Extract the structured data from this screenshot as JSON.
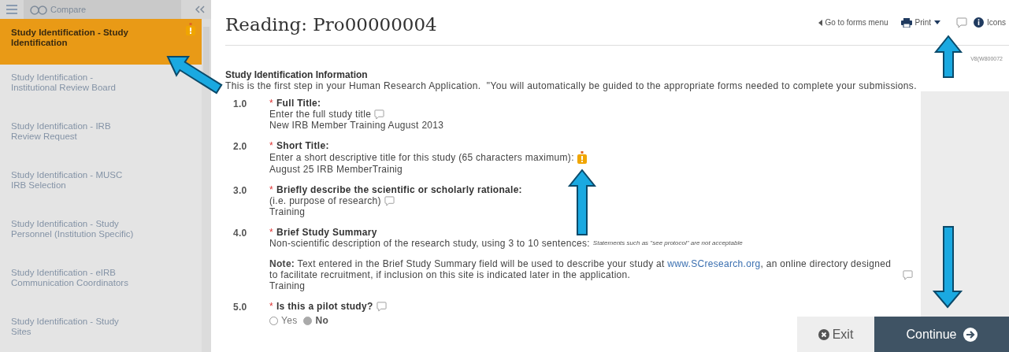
{
  "sidebar": {
    "header": {
      "label": "Compare"
    },
    "items": [
      {
        "label": "Study Identification - Study Identification",
        "selected": true,
        "alert": true
      },
      {
        "label": "Study Identification - Institutional Review Board",
        "selected": false,
        "alert": false
      },
      {
        "label": "Study Identification - IRB Review Request",
        "selected": false,
        "alert": false
      },
      {
        "label": "Study Identification - MUSC IRB Selection",
        "selected": false,
        "alert": false
      },
      {
        "label": "Study Identification - Study Personnel (Institution Specific)",
        "selected": false,
        "alert": false
      },
      {
        "label": "Study Identification - eIRB Communication Coordinators",
        "selected": false,
        "alert": false
      },
      {
        "label": "Study Identification - Study Sites",
        "selected": false,
        "alert": false
      }
    ]
  },
  "page": {
    "title": "Reading: Pro00000004",
    "toolbar": {
      "forms_link": "Go to forms menu",
      "print": "Print",
      "icons": "Icons"
    },
    "version": "V8(W800072",
    "section_title": "Study Identification Information",
    "intro": "This is the first step in your Human Research Application.  \"You will automatically be guided to the appropriate forms needed to complete your submissions.",
    "questions": [
      {
        "number": "1.0",
        "required_mark": "*",
        "label": "Full Title:",
        "help": "Enter the full study title",
        "help_comment": true,
        "answer": "New IRB Member Training August 2013"
      },
      {
        "number": "2.0",
        "required_mark": "*",
        "label": "Short Title:",
        "help": "Enter a short descriptive title for this study (65 characters maximum):",
        "help_alert": true,
        "answer": "August 25 IRB MemberTrainig"
      },
      {
        "number": "3.0",
        "required_mark": "*",
        "label": "Briefly describe the scientific or scholarly rationale:",
        "help": "(i.e. purpose of research)",
        "help_comment": true,
        "answer": "Training"
      },
      {
        "number": "4.0",
        "required_mark": "*",
        "label": "Brief Study Summary",
        "help": "Non-scientific description of the research study, using 3 to 10 sentences:",
        "help_small": "Statements such as \"see protocol\" are not acceptable",
        "note_before": "**Note:** Text entered in the Brief Study Summary field will be used to describe your study at ",
        "note_link": "www.SCresearch.org",
        "note_after": ", an online directory designed to facilitate recruitment, if inclusion on this site is indicated later in the application.",
        "note_comment": true,
        "answer": "Training"
      },
      {
        "number": "5.0",
        "required_mark": "*",
        "label": "Is this a pilot study?",
        "label_comment": true,
        "options": [
          {
            "label": "Yes",
            "selected": false
          },
          {
            "label": "No",
            "selected": true
          }
        ]
      }
    ]
  },
  "footer": {
    "exit": "Exit",
    "continue": "Continue"
  }
}
